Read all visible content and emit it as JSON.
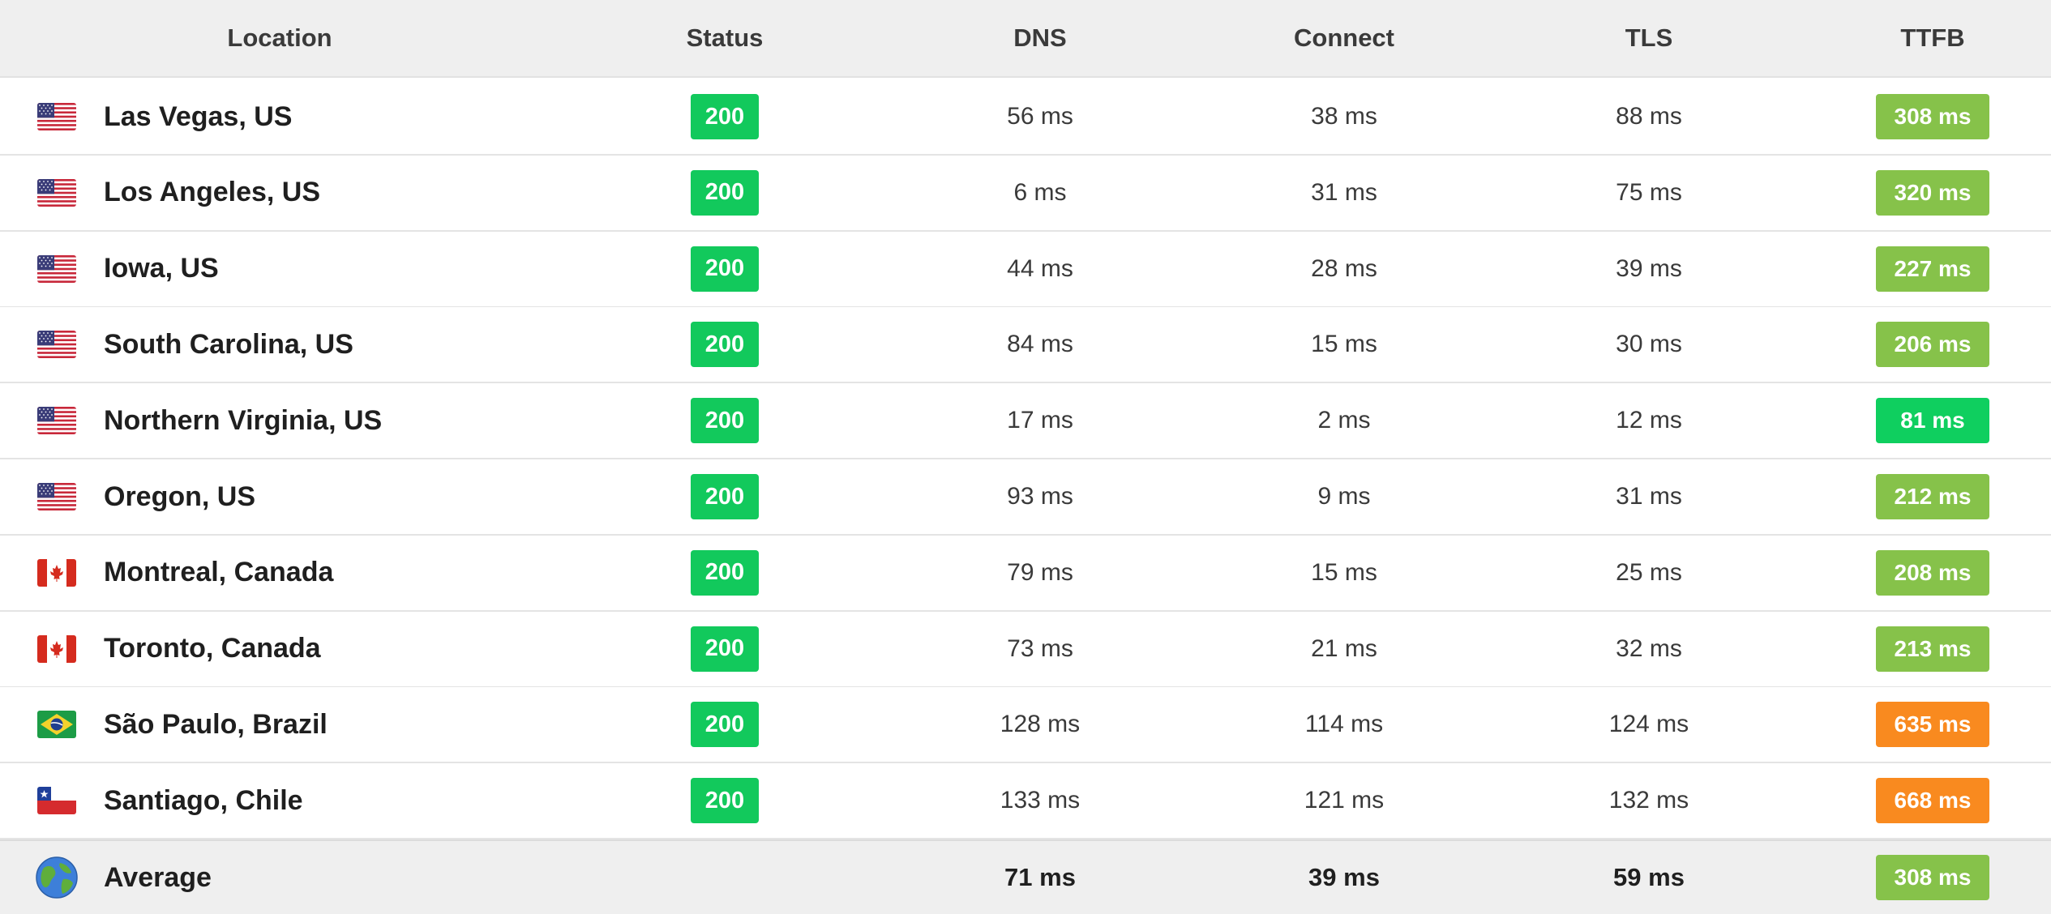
{
  "colors": {
    "status_ok": "#12c95c",
    "ttfb_fast": "#0fcf5f",
    "ttfb_medium": "#86c24a",
    "ttfb_slow": "#f98a1f",
    "header_bg": "#efefef"
  },
  "table": {
    "columns": {
      "location": "Location",
      "status": "Status",
      "dns": "DNS",
      "connect": "Connect",
      "tls": "TLS",
      "ttfb": "TTFB"
    },
    "rows": [
      {
        "flag": "us-flag-icon",
        "location": "Las Vegas, US",
        "status": "200",
        "dns": "56 ms",
        "connect": "38 ms",
        "tls": "88 ms",
        "ttfb": "308 ms",
        "ttfb_level": "medium"
      },
      {
        "flag": "us-flag-icon",
        "location": "Los Angeles, US",
        "status": "200",
        "dns": "6 ms",
        "connect": "31 ms",
        "tls": "75 ms",
        "ttfb": "320 ms",
        "ttfb_level": "medium"
      },
      {
        "flag": "us-flag-icon",
        "location": "Iowa, US",
        "status": "200",
        "dns": "44 ms",
        "connect": "28 ms",
        "tls": "39 ms",
        "ttfb": "227 ms",
        "ttfb_level": "medium"
      },
      {
        "flag": "us-flag-icon",
        "location": "South Carolina, US",
        "status": "200",
        "dns": "84 ms",
        "connect": "15 ms",
        "tls": "30 ms",
        "ttfb": "206 ms",
        "ttfb_level": "medium"
      },
      {
        "flag": "us-flag-icon",
        "location": "Northern Virginia, US",
        "status": "200",
        "dns": "17 ms",
        "connect": "2 ms",
        "tls": "12 ms",
        "ttfb": "81 ms",
        "ttfb_level": "fast"
      },
      {
        "flag": "us-flag-icon",
        "location": "Oregon, US",
        "status": "200",
        "dns": "93 ms",
        "connect": "9 ms",
        "tls": "31 ms",
        "ttfb": "212 ms",
        "ttfb_level": "medium"
      },
      {
        "flag": "canada-flag-icon",
        "location": "Montreal, Canada",
        "status": "200",
        "dns": "79 ms",
        "connect": "15 ms",
        "tls": "25 ms",
        "ttfb": "208 ms",
        "ttfb_level": "medium"
      },
      {
        "flag": "canada-flag-icon",
        "location": "Toronto, Canada",
        "status": "200",
        "dns": "73 ms",
        "connect": "21 ms",
        "tls": "32 ms",
        "ttfb": "213 ms",
        "ttfb_level": "medium"
      },
      {
        "flag": "brazil-flag-icon",
        "location": "São Paulo, Brazil",
        "status": "200",
        "dns": "128 ms",
        "connect": "114 ms",
        "tls": "124 ms",
        "ttfb": "635 ms",
        "ttfb_level": "slow"
      },
      {
        "flag": "chile-flag-icon",
        "location": "Santiago, Chile",
        "status": "200",
        "dns": "133 ms",
        "connect": "121 ms",
        "tls": "132 ms",
        "ttfb": "668 ms",
        "ttfb_level": "slow"
      }
    ],
    "average": {
      "icon": "globe-icon",
      "label": "Average",
      "dns": "71 ms",
      "connect": "39 ms",
      "tls": "59 ms",
      "ttfb": "308 ms",
      "ttfb_level": "medium"
    }
  }
}
